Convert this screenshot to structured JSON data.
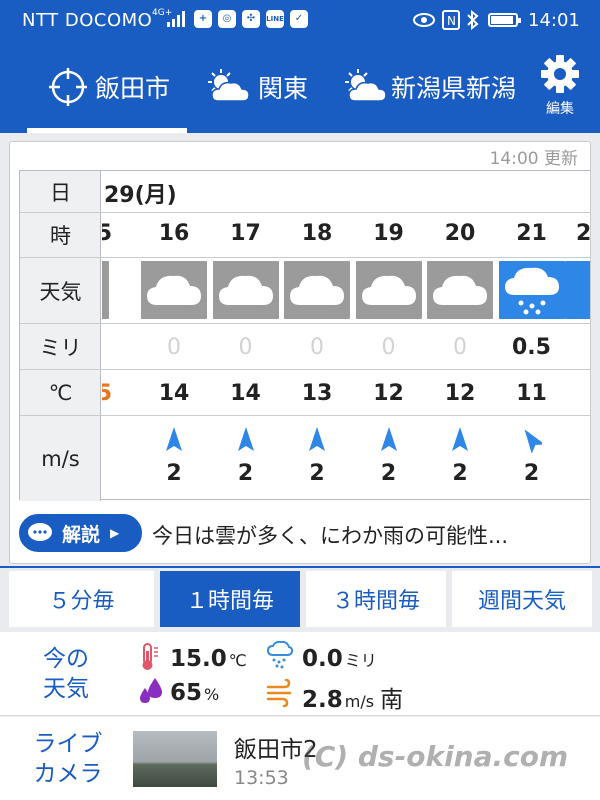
{
  "status_bar": {
    "carrier": "NTT DOCOMO",
    "network": "4G+",
    "time": "14:01",
    "battery_level": 0.9
  },
  "locations": [
    {
      "label": "飯田市",
      "icon": "location-crosshair-icon",
      "active": true
    },
    {
      "label": "関東",
      "icon": "sun-cloud-icon",
      "active": false
    },
    {
      "label": "新潟県新潟",
      "icon": "sun-cloud-icon",
      "active": false
    }
  ],
  "settings_label": "編集",
  "forecast": {
    "updated": "14:00 更新",
    "row_headers": {
      "day": "日",
      "hour": "時",
      "weather": "天気",
      "precip": "ミリ",
      "temp": "℃",
      "wind": "m/s"
    },
    "date": "29(月)",
    "partial_left_hour": "5",
    "partial_left_temp": "5",
    "columns": [
      {
        "hour": "16",
        "weather": "cloudy",
        "precip": "0",
        "temp": "14",
        "wind": "2",
        "wind_dir": "north"
      },
      {
        "hour": "17",
        "weather": "cloudy",
        "precip": "0",
        "temp": "14",
        "wind": "2",
        "wind_dir": "north"
      },
      {
        "hour": "18",
        "weather": "cloudy",
        "precip": "0",
        "temp": "13",
        "wind": "2",
        "wind_dir": "north"
      },
      {
        "hour": "19",
        "weather": "cloudy",
        "precip": "0",
        "temp": "12",
        "wind": "2",
        "wind_dir": "north"
      },
      {
        "hour": "20",
        "weather": "cloudy",
        "precip": "0",
        "temp": "12",
        "wind": "2",
        "wind_dir": "north"
      },
      {
        "hour": "21",
        "weather": "rain",
        "precip": "0.5",
        "temp": "11",
        "wind": "2",
        "wind_dir": "north-west"
      }
    ],
    "partial_right_hour": "2",
    "explain_label": "解説",
    "summary": "今日は雲が多く、にわか雨の可能性..."
  },
  "interval_tabs": [
    {
      "label": "５分毎",
      "active": false
    },
    {
      "label": "１時間毎",
      "active": true
    },
    {
      "label": "３時間毎",
      "active": false
    },
    {
      "label": "週間天気",
      "active": false
    }
  ],
  "current": {
    "title_line1": "今の",
    "title_line2": "天気",
    "temp": "15.0",
    "temp_unit": "℃",
    "precip": "0.0",
    "precip_unit": "ミリ",
    "humidity": "65",
    "humidity_unit": "%",
    "wind": "2.8",
    "wind_unit": "m/s",
    "wind_dir": "南"
  },
  "live_camera": {
    "title_line1": "ライブ",
    "title_line2": "カメラ",
    "name": "飯田市2",
    "time": "13:53"
  },
  "watermark": "(C) ds-okina.com",
  "colors": {
    "brand_blue": "#1a5dc2",
    "cloud_gray": "#9b9b9b",
    "rain_blue": "#2e86e6",
    "temp_orange": "#e8741e"
  }
}
